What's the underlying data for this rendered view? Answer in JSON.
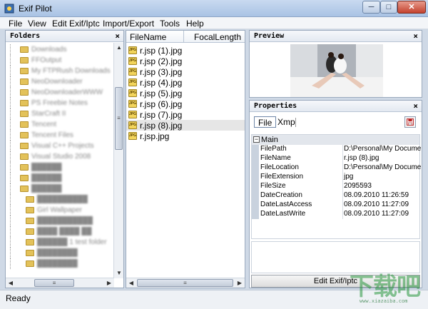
{
  "window": {
    "title": "Exif Pilot",
    "controls": {
      "minimize": "─",
      "maximize": "□",
      "close": "✕"
    }
  },
  "menu": [
    "File",
    "View",
    "Edit Exif/Iptc",
    "Import/Export",
    "Tools",
    "Help"
  ],
  "folders_panel": {
    "title": "Folders",
    "close": "×",
    "items": [
      "Downloads",
      "FFOutput",
      "My FTPRush Downloads",
      "NeoDownloader",
      "NeoDownloaderWWW",
      "PS Freebie Notes",
      "StarCraft II",
      "Tencent",
      "Tencent Files",
      "Visual C++ Projects",
      "Visual Studio 2008",
      "██████",
      "██████",
      "██████",
      "██████████",
      "Girl Wallpaper",
      "███████████",
      "████ ████ ██",
      "██████ 1 test folder",
      "████████",
      "████████"
    ]
  },
  "file_list": {
    "columns": [
      "FileName",
      "FocalLength"
    ],
    "files": [
      "r.jsp (1).jpg",
      "r.jsp (2).jpg",
      "r.jsp (3).jpg",
      "r.jsp (4).jpg",
      "r.jsp (5).jpg",
      "r.jsp (6).jpg",
      "r.jsp (7).jpg",
      "r.jsp (8).jpg",
      "r.jsp.jpg"
    ],
    "selected_index": 7
  },
  "preview_panel": {
    "title": "Preview",
    "close": "×"
  },
  "properties_panel": {
    "title": "Properties",
    "close": "×",
    "tabs": [
      "File",
      "Xmp"
    ],
    "active_tab": "File",
    "category": "Main",
    "rows": [
      {
        "key": "FilePath",
        "value": "D:\\Personal\\My Docume..."
      },
      {
        "key": "FileName",
        "value": "r.jsp (8).jpg"
      },
      {
        "key": "FileLocation",
        "value": "D:\\Personal\\My Docume..."
      },
      {
        "key": "FileExtension",
        "value": "jpg"
      },
      {
        "key": "FileSize",
        "value": "2095593"
      },
      {
        "key": "DateCreation",
        "value": "08.09.2010 11:26:59"
      },
      {
        "key": "DateLastAccess",
        "value": "08.09.2010 11:27:09"
      },
      {
        "key": "DateLastWrite",
        "value": "08.09.2010 11:27:09"
      }
    ],
    "edit_button": "Edit Exif/Iptc"
  },
  "status": {
    "text": "Ready"
  },
  "watermark": {
    "text": "下载吧",
    "url": "www.xiazaiba.com"
  }
}
